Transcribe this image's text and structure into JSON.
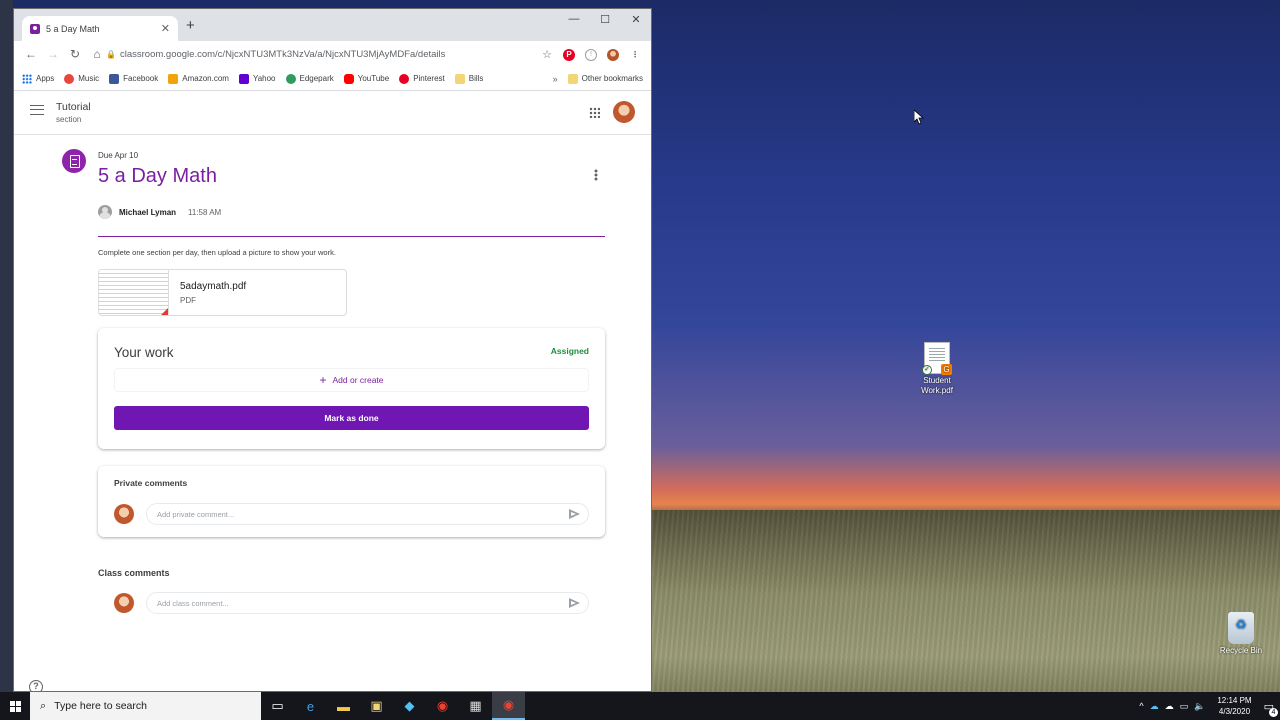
{
  "browser": {
    "tab_title": "5 a Day Math",
    "url": "classroom.google.com/c/NjcxNTU3MTk3NzVa/a/NjcxNTU3MjAyMDFa/details",
    "bookmarks": [
      {
        "label": "Apps",
        "icon": "apps-grid-icon",
        "color": "#1a73e8"
      },
      {
        "label": "Music",
        "icon": "music-icon",
        "color": "#e8453c"
      },
      {
        "label": "Facebook",
        "icon": "facebook-icon",
        "color": "#3b5998"
      },
      {
        "label": "Amazon.com",
        "icon": "amazon-icon",
        "color": "#f0a30a"
      },
      {
        "label": "Yahoo",
        "icon": "yahoo-icon",
        "color": "#6001d2"
      },
      {
        "label": "Edgepark",
        "icon": "edgepark-icon",
        "color": "#2e9c5c"
      },
      {
        "label": "YouTube",
        "icon": "youtube-icon",
        "color": "#ff0000"
      },
      {
        "label": "Pinterest",
        "icon": "pinterest-icon",
        "color": "#e60023"
      },
      {
        "label": "Bills",
        "icon": "folder-icon",
        "color": "#f2d675"
      }
    ],
    "other_bookmarks": "Other bookmarks"
  },
  "classroom": {
    "class_name": "Tutorial",
    "section": "section",
    "due": "Due Apr 10",
    "title": "5 a Day Math",
    "author": "Michael Lyman",
    "time": "11:58 AM",
    "instructions": "Complete one section per day, then upload a picture to show your work.",
    "attachment": {
      "name": "5adaymath.pdf",
      "type": "PDF"
    },
    "your_work": {
      "title": "Your work",
      "status": "Assigned",
      "add_label": "Add or create",
      "done_label": "Mark as done"
    },
    "private_comments": {
      "title": "Private comments",
      "placeholder": "Add private comment..."
    },
    "class_comments": {
      "title": "Class comments",
      "placeholder": "Add class comment..."
    },
    "accent_color": "#7b1fa2",
    "assigned_color": "#1e8e3e"
  },
  "desktop": {
    "icons": [
      {
        "label": "Student Work.pdf",
        "icon": "pdf-file-icon"
      },
      {
        "label": "Recycle Bin",
        "icon": "recycle-bin-icon"
      }
    ]
  },
  "taskbar": {
    "search_placeholder": "Type here to search",
    "time": "12:14 PM",
    "date": "4/3/2020",
    "notification_count": "4"
  }
}
